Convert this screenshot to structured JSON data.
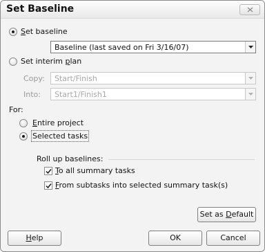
{
  "window": {
    "title": "Set Baseline"
  },
  "set_baseline": {
    "label_prefix": "",
    "label_mnemonic": "S",
    "label_rest": "et baseline",
    "selected": true,
    "combo_value": "Baseline (last saved on Fri 3/16/07)"
  },
  "interim": {
    "label_prefix": "Set interim ",
    "label_mnemonic": "p",
    "label_rest": "lan",
    "selected": false,
    "copy_label": "Copy:",
    "copy_value": "Start/Finish",
    "into_label": "Into:",
    "into_value": "Start1/Finish1"
  },
  "for": {
    "label": "For:",
    "entire_prefix": "",
    "entire_mnemonic": "E",
    "entire_rest": "ntire project",
    "entire_selected": false,
    "selected_tasks_label": "Selected tasks",
    "selected_tasks_selected": true
  },
  "rollup": {
    "label": "Roll up baselines:",
    "to_all_prefix": "",
    "to_all_mnemonic": "T",
    "to_all_rest": "o all summary tasks",
    "to_all_checked": true,
    "from_sub_prefix": "",
    "from_sub_mnemonic": "F",
    "from_sub_rest": "rom subtasks into selected summary task(s)",
    "from_sub_checked": true
  },
  "buttons": {
    "set_default_prefix": "Set as ",
    "set_default_mnemonic": "D",
    "set_default_rest": "efault",
    "help_mnemonic": "H",
    "help_rest": "elp",
    "ok": "OK",
    "cancel": "Cancel"
  }
}
